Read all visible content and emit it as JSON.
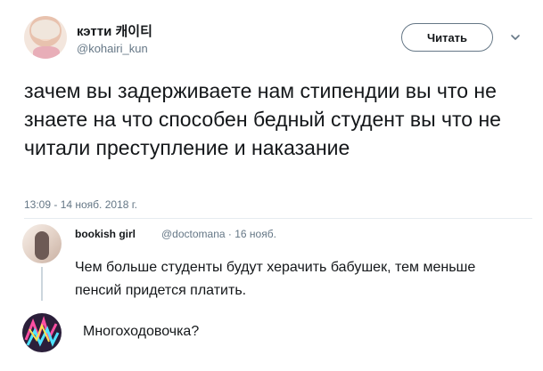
{
  "tweet": {
    "display_name": "кэтти 캐이티",
    "handle": "@kohairi_kun",
    "follow_label": "Читать",
    "text": "зачем вы задерживаете нам стипендии вы что не знаете на что способен бедный студент вы что не читали преступление и наказание",
    "timestamp": "13:09 - 14 нояб. 2018 г."
  },
  "reply": {
    "author": "bookish girl",
    "meta": "@doctomana · 16 нояб.",
    "text": "Чем больше студенты будут херачить бабушек, тем меньше пенсий придется платить."
  },
  "reply2": {
    "text": "Многоходовочка?"
  },
  "colors": {
    "text": "#14171a",
    "muted": "#657786",
    "divider": "#e6ecf0",
    "thread_line": "#ccd6dd"
  },
  "icons": {
    "menu": "chevron-down-icon"
  }
}
